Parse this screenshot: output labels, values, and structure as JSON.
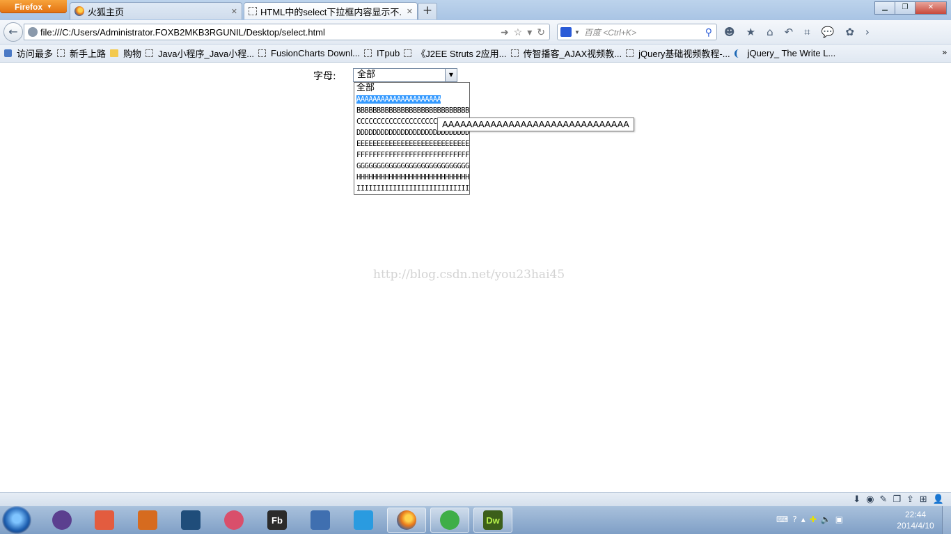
{
  "browser": {
    "app_button": "Firefox",
    "tabs": [
      {
        "label": "火狐主页",
        "active": false
      },
      {
        "label": "HTML中的select下拉框内容显示不...",
        "active": true
      }
    ],
    "new_tab": "+",
    "window_buttons": {
      "minimize": "▁",
      "maximize": "❐",
      "close": "✕"
    }
  },
  "nav": {
    "url": "file:///C:/Users/Administrator.FOXB2MKB3RGUNIL/Desktop/select.html",
    "search_placeholder": "百度 <Ctrl+K>"
  },
  "bookmarks": [
    {
      "label": "访问最多",
      "icon": "star"
    },
    {
      "label": "新手上路",
      "icon": "page"
    },
    {
      "label": "购物",
      "icon": "folder"
    },
    {
      "label": "Java小程序_Java小程...",
      "icon": "page"
    },
    {
      "label": "FusionCharts Downl...",
      "icon": "page"
    },
    {
      "label": "ITpub",
      "icon": "page"
    },
    {
      "label": "《J2EE Struts 2应用...",
      "icon": "page"
    },
    {
      "label": "传智播客_AJAX视频教...",
      "icon": "page"
    },
    {
      "label": "jQuery基础视频教程-...",
      "icon": "page"
    },
    {
      "label": "jQuery_ The Write L...",
      "icon": "jquery"
    }
  ],
  "bookmarks_more": "»",
  "page": {
    "field_label": "字母:",
    "select_value": "全部",
    "options": [
      "全部",
      "AAAAAAAAAAAAAAAAAAAAA",
      "BBBBBBBBBBBBBBBBBBBBBBBBBBBBBBB",
      "CCCCCCCCCCCCCCCCCCCCCCCCCCCCCCC",
      "DDDDDDDDDDDDDDDDDDDDDDDDDDDDDDD",
      "EEEEEEEEEEEEEEEEEEEEEEEEEEEEEEE",
      "FFFFFFFFFFFFFFFFFFFFFFFFFFFFFFF",
      "GGGGGGGGGGGGGGGGGGGGGGGGGGGGGGG",
      "HHHHHHHHHHHHHHHHHHHHHHHHHHHHHHH",
      "IIIIIIIIIIIIIIIIIIIIIIIIIIIIIII"
    ],
    "highlighted_index": 1,
    "tooltip": "AAAAAAAAAAAAAAAAAAAAAAAAAAAAAAA",
    "watermark": "http://blog.csdn.net/you23hai45"
  },
  "taskbar": {
    "clock_time": "22:44",
    "clock_date": "2014/4/10",
    "apps": [
      {
        "name": "eclipse",
        "color": "#5b3f8f"
      },
      {
        "name": "notepad-plus",
        "color": "#e35c3f"
      },
      {
        "name": "matlab",
        "color": "#d66b1f"
      },
      {
        "name": "s-app",
        "color": "#1f4d7a"
      },
      {
        "name": "snipping-tool",
        "color": "#d94f6b"
      },
      {
        "name": "flash-builder",
        "color": "#2b2b2b",
        "text": "Fb"
      },
      {
        "name": "virtualbox",
        "color": "#3f6fb0"
      },
      {
        "name": "cloud-app",
        "color": "#2a9be0"
      },
      {
        "name": "firefox",
        "color": "#e8781b"
      },
      {
        "name": "browser-e",
        "color": "#3fae48"
      },
      {
        "name": "dreamweaver",
        "color": "#3c5f1a",
        "text": "Dw"
      }
    ]
  }
}
